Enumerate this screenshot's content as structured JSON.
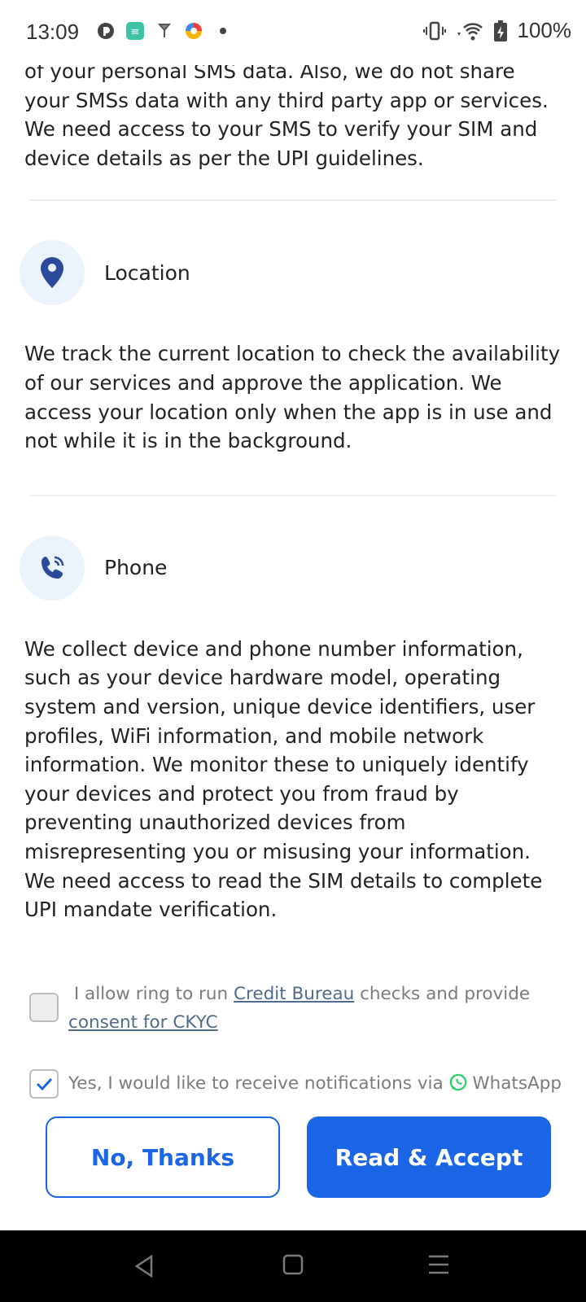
{
  "status_bar": {
    "time": "13:09",
    "battery": "100%",
    "left_icons": [
      "app-icon-1",
      "app-icon-2",
      "app-icon-3",
      "app-icon-4",
      "dot-icon"
    ],
    "right_icons": [
      "vibrate-icon",
      "wifi-icon",
      "battery-icon"
    ]
  },
  "sms": {
    "partial_line": "of your personal SMS data. Also, we do not share your SMSs data with any third party app or services.",
    "text2": "We need access to your SMS to verify your SIM and device details as per the UPI guidelines."
  },
  "location": {
    "title": "Location",
    "icon": "location-pin-icon",
    "text": "We track the current location to check the availability of our services and approve the application. We access your location only when the app is in use and not while it is in the background."
  },
  "phone": {
    "title": "Phone",
    "icon": "phone-icon",
    "text": "We collect device and phone number information, such as your device hardware model, operating system and version, unique device identifiers, user profiles, WiFi information, and mobile network information. We monitor these to uniquely identify your devices and protect you from fraud by preventing unauthorized devices from misrepresenting you or misusing your information.",
    "text2": "We need access to read the SIM details to complete UPI mandate verification."
  },
  "consent": {
    "credit_prefix": "I allow ring to run ",
    "credit_link": "Credit Bureau",
    "credit_mid": " checks and provide ",
    "ckyc_link": "consent for CKYC",
    "credit_checked": false,
    "whatsapp_text": "Yes, I would like to receive notifications via ",
    "whatsapp_label": "WhatsApp",
    "whatsapp_checked": true
  },
  "buttons": {
    "decline": "No, Thanks",
    "accept": "Read & Accept"
  },
  "colors": {
    "primary": "#1a66e6",
    "icon_blue": "#2b4a9a",
    "whatsapp_green": "#25d366"
  }
}
